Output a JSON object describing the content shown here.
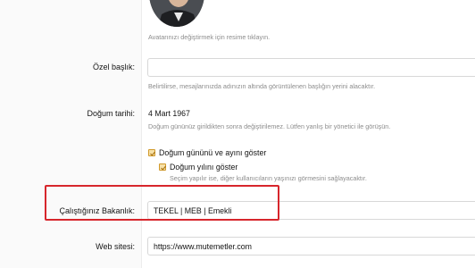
{
  "avatar_hint": "Avatarınızı değiştirmek için resime tıklayın.",
  "custom_title": {
    "label": "Özel başlık:",
    "value": "",
    "hint": "Belirtilirse, mesajlarınızda adınızın altında görüntülenen başlığın yerini alacaktır."
  },
  "birthday": {
    "label": "Doğum tarihi:",
    "value": "4 Mart 1967",
    "hint": "Doğum gününüz girildikten sonra değiştirilemez. Lütfen yanlış bir yönetici ile görüşün.",
    "show_day_month": {
      "label": "Doğum gününü ve ayını göster",
      "checked": true
    },
    "show_year": {
      "label": "Doğum yılını göster",
      "checked": true,
      "hint": "Seçim yapılır ise, diğer kullanıcıların yaşınızı görmesini sağlayacaktır."
    }
  },
  "ministry": {
    "label": "Çalıştığınız Bakanlık:",
    "value": "TEKEL | MEB | Emekli"
  },
  "website": {
    "label": "Web sitesi:",
    "value": "https://www.mutemetler.com"
  },
  "colors": {
    "highlight": "#d7262c",
    "checkbox": "#d19a2b"
  }
}
